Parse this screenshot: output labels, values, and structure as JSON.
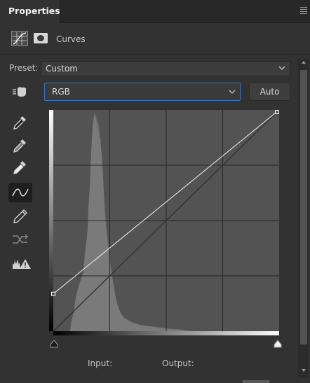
{
  "panel": {
    "tab_title": "Properties",
    "menu_icon": "hamburger-menu-icon"
  },
  "adjustment": {
    "type_label": "Curves",
    "type_icon": "curves-adjustment-icon",
    "mask_icon": "layer-mask-icon"
  },
  "preset": {
    "label": "Preset:",
    "value": "Custom"
  },
  "channel": {
    "value": "RGB",
    "auto_label": "Auto"
  },
  "tools": [
    {
      "name": "target-adjust-hand-icon"
    },
    {
      "name": "black-point-eyedropper-icon"
    },
    {
      "name": "gray-point-eyedropper-icon"
    },
    {
      "name": "white-point-eyedropper-icon"
    },
    {
      "name": "curve-point-edit-icon",
      "active": true
    },
    {
      "name": "pencil-draw-icon"
    },
    {
      "name": "smooth-curve-icon"
    },
    {
      "name": "clipping-warning-icon"
    }
  ],
  "curve": {
    "input_label": "Input:",
    "output_label": "Output:",
    "points": [
      [
        0,
        43
      ],
      [
        255,
        255
      ]
    ],
    "range": [
      0,
      255
    ],
    "grid_divisions": 4
  },
  "colors": {
    "panel_bg": "#323232",
    "graph_bg": "#535353",
    "histogram": "#7a7a7a",
    "accent_border": "#3a74c8"
  }
}
